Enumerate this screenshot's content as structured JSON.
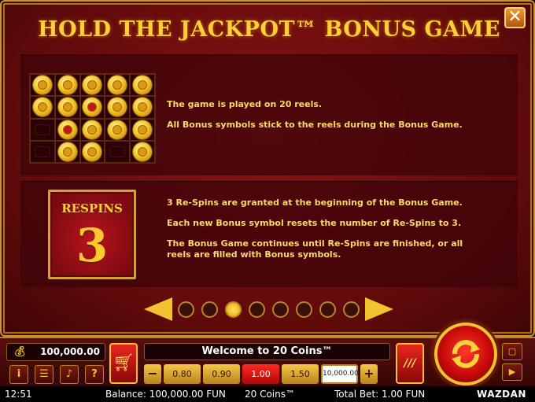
{
  "title": "HOLD THE JACKPOT™ BONUS GAME",
  "close_label": "✕",
  "panel1": {
    "line1": "The game is played on 20 reels.",
    "line2": "All Bonus symbols stick to the reels during the Bonus Game.",
    "grid": [
      [
        "5",
        "5",
        "5",
        "5",
        "2"
      ],
      [
        "2",
        "3",
        "7",
        "3",
        "1"
      ],
      [
        "",
        "5",
        "5",
        "3",
        "1"
      ],
      [
        "",
        "5",
        "5",
        "",
        "1"
      ]
    ],
    "red_coins": [
      "7",
      "5"
    ]
  },
  "panel2": {
    "badge_title": "RESPINS",
    "badge_number": "3",
    "line1": "3 Re-Spins are granted at the beginning of the Bonus Game.",
    "line2": "Each new Bonus symbol resets the number of Re-Spins to 3.",
    "line3": "The Bonus Game continues until Re-Spins are finished, or all reels are filled with Bonus symbols."
  },
  "pagination": {
    "pages": 8,
    "active_index": 2
  },
  "controls": {
    "balance": "100,000.00",
    "welcome": "Welcome to 20 Coins™",
    "bets": [
      "0.80",
      "0.90",
      "1.00",
      "1.50",
      "10,000.00"
    ],
    "selected_bet": "1.00",
    "minus": "−",
    "plus": "+",
    "info": "i",
    "menu": "☰",
    "sound": "♪",
    "help": "?",
    "auto": "///"
  },
  "status": {
    "time": "12:51",
    "balance": "Balance: 100,000.00 FUN",
    "game": "20 Coins™",
    "total_bet": "Total Bet: 1.00 FUN",
    "brand": "WAZDAN"
  },
  "colors": {
    "accent": "#f2c230",
    "background": "#6a0c0c",
    "selected": "#e8261e"
  }
}
